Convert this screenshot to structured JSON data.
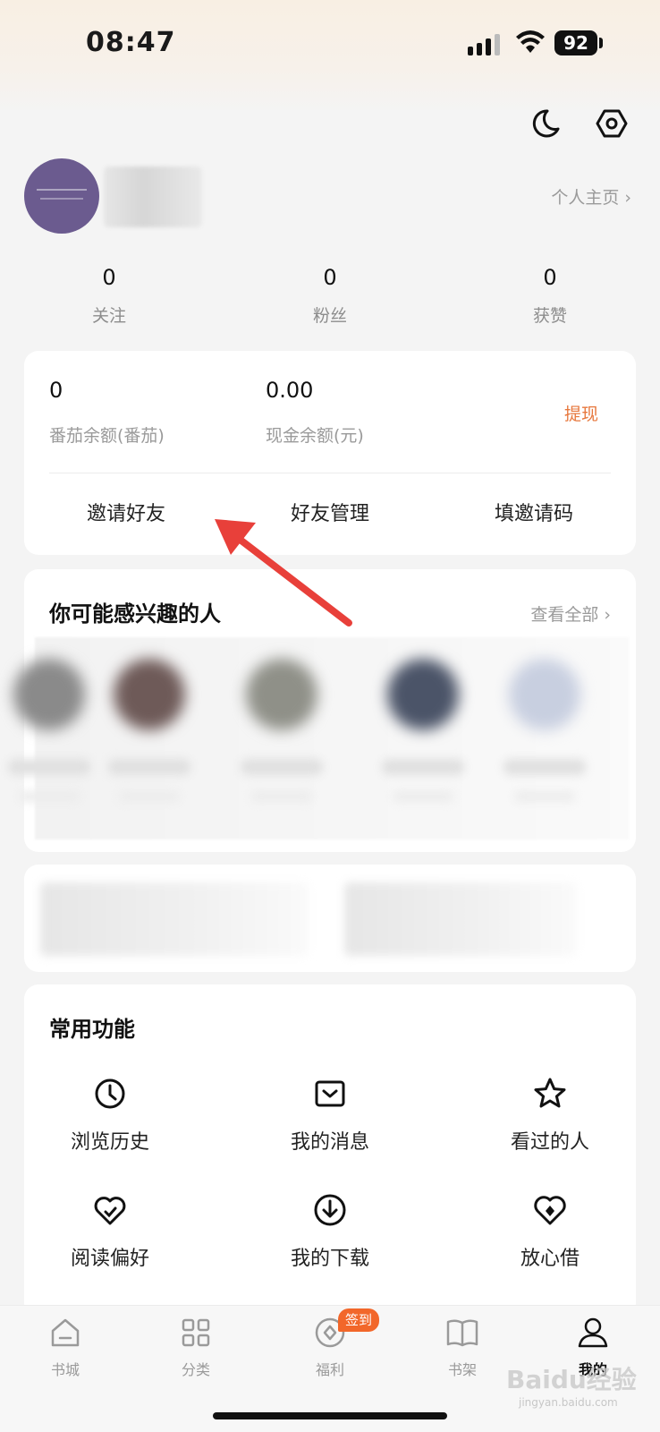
{
  "status_bar": {
    "time": "08:47",
    "battery": "92"
  },
  "profile": {
    "home_link": "个人主页 ›"
  },
  "stats": [
    {
      "value": "0",
      "label": "关注"
    },
    {
      "value": "0",
      "label": "粉丝"
    },
    {
      "value": "0",
      "label": "获赞"
    }
  ],
  "wallet": {
    "tomato_balance": {
      "value": "0",
      "label": "番茄余额(番茄)"
    },
    "cash_balance": {
      "value": "0.00",
      "label": "现金余额(元)"
    },
    "withdraw": "提现",
    "actions": [
      "邀请好友",
      "好友管理",
      "填邀请码"
    ]
  },
  "people": {
    "title": "你可能感兴趣的人",
    "see_all": "查看全部 ›"
  },
  "functions": {
    "title": "常用功能",
    "items": [
      {
        "label": "浏览历史",
        "icon": "clock-icon"
      },
      {
        "label": "我的消息",
        "icon": "message-icon"
      },
      {
        "label": "看过的人",
        "icon": "star-icon"
      },
      {
        "label": "阅读偏好",
        "icon": "heart-check-icon"
      },
      {
        "label": "我的下载",
        "icon": "download-icon"
      },
      {
        "label": "放心借",
        "icon": "heart-diamond-icon"
      }
    ]
  },
  "tabs": [
    {
      "label": "书城",
      "icon": "home-icon"
    },
    {
      "label": "分类",
      "icon": "grid-icon"
    },
    {
      "label": "福利",
      "icon": "coin-icon"
    },
    {
      "label": "书架",
      "icon": "book-icon"
    },
    {
      "label": "我的",
      "icon": "user-icon",
      "active": true
    }
  ],
  "tab_badge": "签到",
  "watermark": {
    "main": "Baidu经验",
    "sub": "jingyan.baidu.com"
  },
  "colors": {
    "accent": "#e7773c",
    "badge": "#f2672a",
    "avatar": "#6b5b8f",
    "arrow": "#e8403a"
  }
}
